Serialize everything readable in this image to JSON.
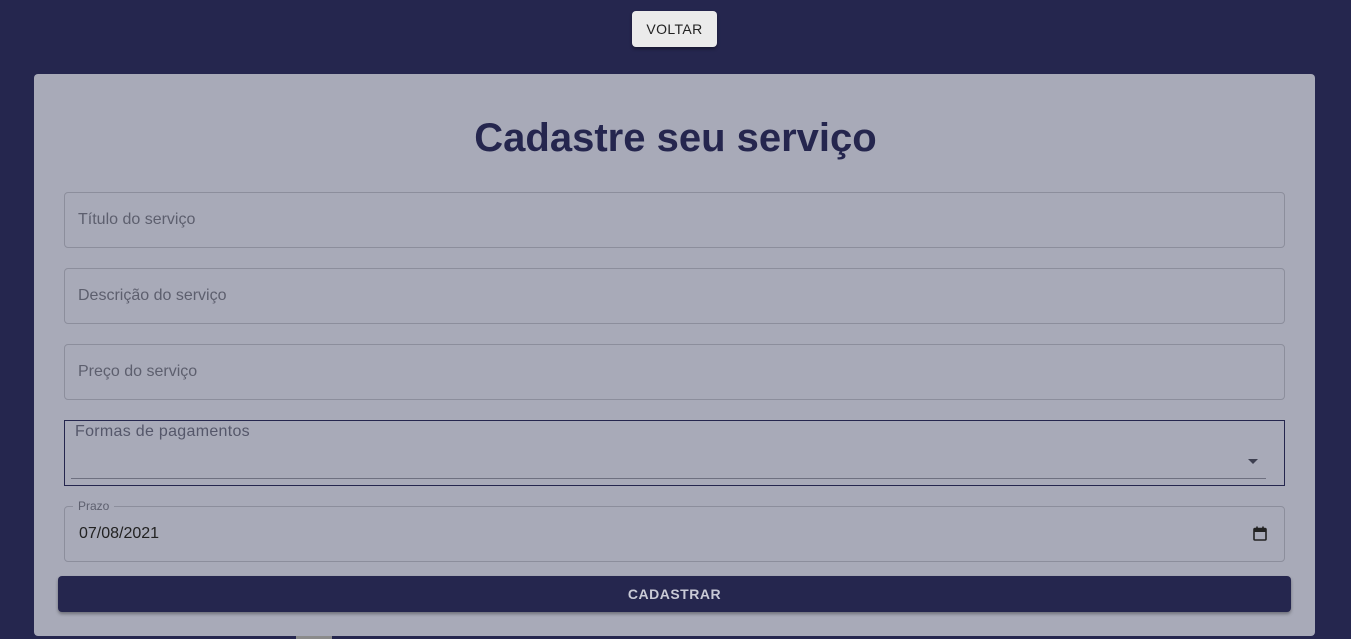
{
  "header": {
    "back_label": "VOLTAR"
  },
  "form": {
    "title": "Cadastre seu serviço",
    "fields": {
      "title_placeholder": "Título do serviço",
      "description_placeholder": "Descrição do serviço",
      "price_placeholder": "Preço do serviço"
    },
    "payment_select": {
      "label": "Formas de pagamentos",
      "value": ""
    },
    "deadline": {
      "label": "Prazo",
      "value": "07/08/2021"
    },
    "submit_label": "CADASTRAR"
  },
  "colors": {
    "background": "#25264e",
    "card": "#a8aab8",
    "accent": "#25264e"
  },
  "icons": {
    "select_arrow": "arrow-drop-down-icon",
    "date_picker": "calendar-icon"
  }
}
